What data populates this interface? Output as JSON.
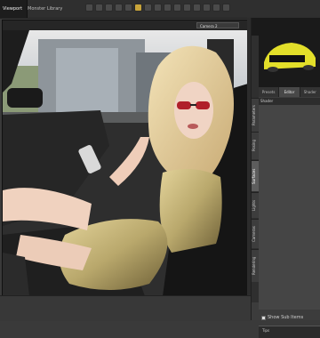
{
  "header": {
    "tab_viewport": "Viewport",
    "tab_library": "Monster Library"
  },
  "viewport": {
    "camera": "Camera 2"
  },
  "panel": {
    "tabs": [
      "Presets",
      "Editor",
      "Shader Baker"
    ],
    "sub_header": "Shader",
    "side_tabs": [
      "Parameters",
      "Posing",
      "Surfaces",
      "Lights",
      "Cameras",
      "Rendering"
    ],
    "show_sub_items": "Show Sub Items",
    "tips": "Tips"
  },
  "colors": {
    "accent": "#c8a43a",
    "car_yellow": "#e3df2a"
  }
}
